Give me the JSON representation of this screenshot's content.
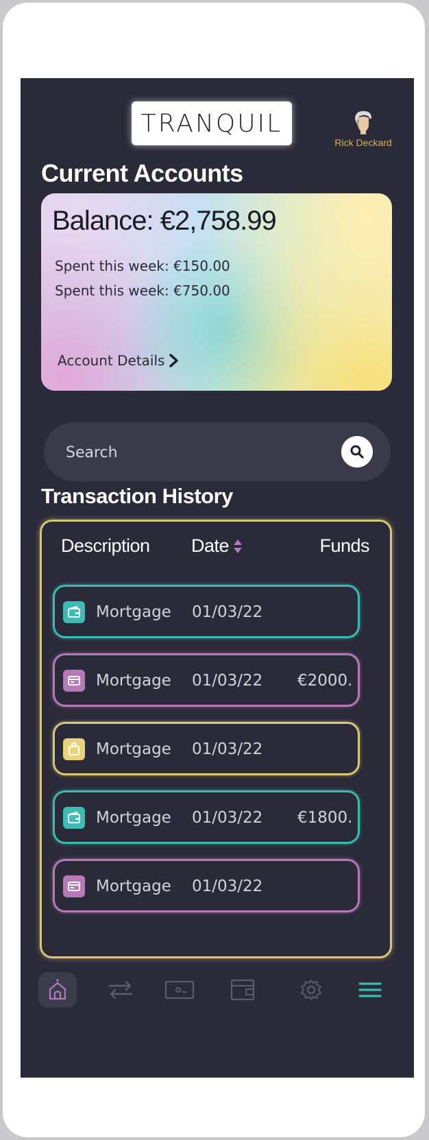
{
  "brand": {
    "logo_text": "TRANQUIL"
  },
  "profile": {
    "name": "Rick Deckard"
  },
  "current_accounts": {
    "title": "Current Accounts",
    "balance": "Balance: €2,758.99",
    "spent_1": "Spent this week: €150.00",
    "spent_2": "Spent this week: €750.00",
    "details_link": "Account Details"
  },
  "search": {
    "placeholder": "Search"
  },
  "history": {
    "title": "Transaction History",
    "columns": {
      "description": "Description",
      "date": "Date",
      "funds": "Funds"
    },
    "rows": [
      {
        "icon": "wallet-icon",
        "description": "Mortgage",
        "date": "01/03/22",
        "funds": "",
        "color": "#3bbcb4"
      },
      {
        "icon": "card-icon",
        "description": "Mortgage",
        "date": "01/03/22",
        "funds": "€2000.",
        "color": "#b77ab8"
      },
      {
        "icon": "bag-icon",
        "description": "Mortgage",
        "date": "01/03/22",
        "funds": "",
        "color": "#d8c774"
      },
      {
        "icon": "wallet-icon",
        "description": "Mortgage",
        "date": "01/03/22",
        "funds": "€1800.",
        "color": "#3bbcb4"
      },
      {
        "icon": "card-icon",
        "description": "Mortgage",
        "date": "01/03/22",
        "funds": "",
        "color": "#b77ab8"
      }
    ]
  },
  "nav": {
    "items": [
      "home-icon",
      "transfer-icon",
      "cash-icon",
      "wallet-icon",
      "settings-icon",
      "menu-icon"
    ],
    "active": "home-icon"
  },
  "colors": {
    "background": "#2a2a38",
    "teal": "#3bbcb4",
    "purple": "#b77ab8",
    "gold": "#d8c774"
  }
}
